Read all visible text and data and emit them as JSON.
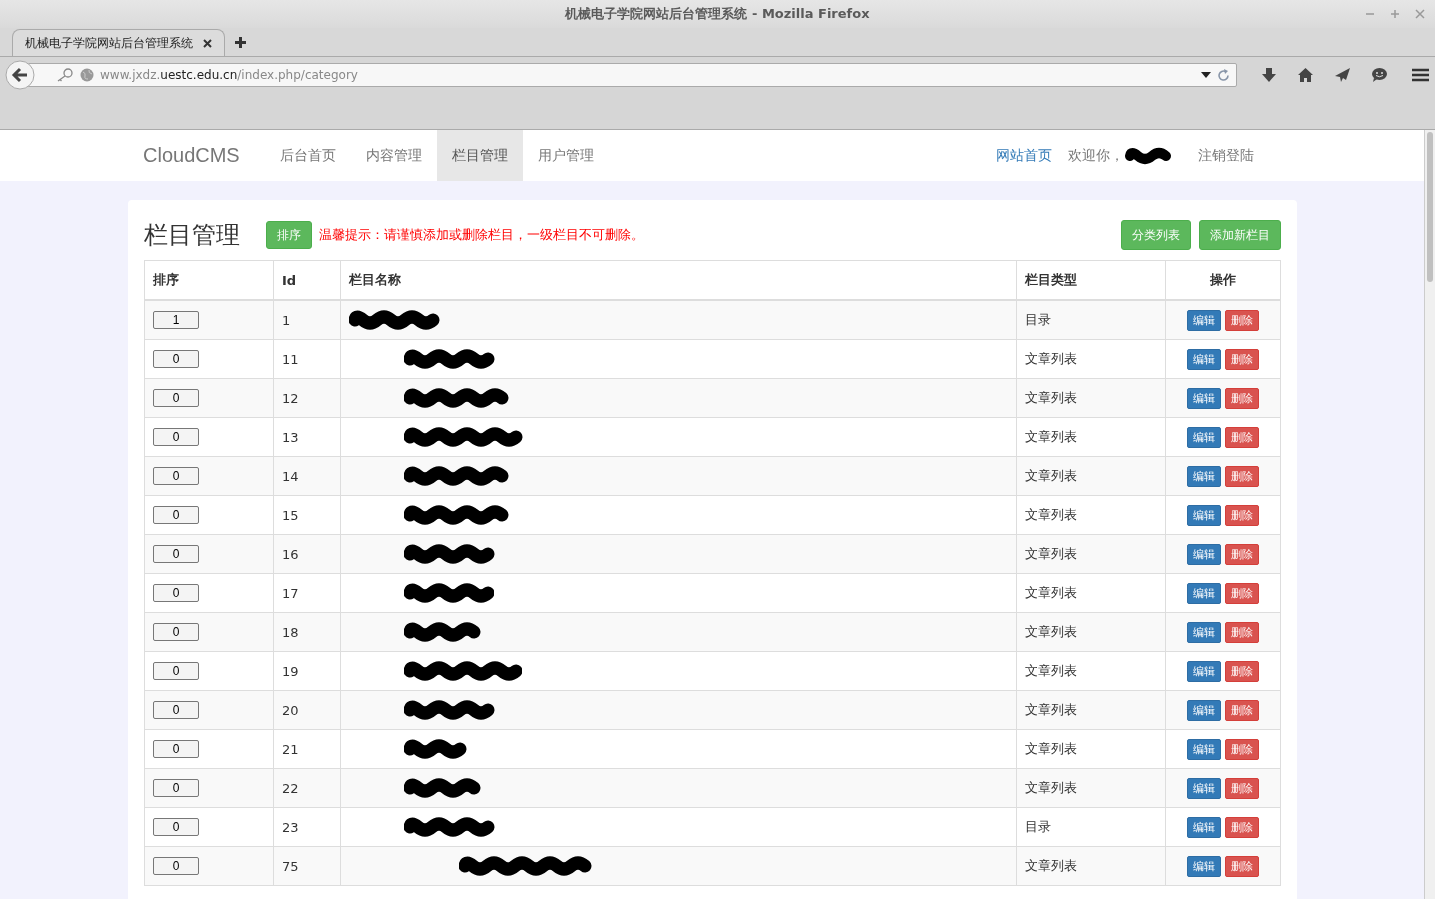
{
  "window": {
    "title": "机械电子学院网站后台管理系统 - Mozilla Firefox"
  },
  "tabs": [
    {
      "label": "机械电子学院网站后台管理系统",
      "selected": true
    }
  ],
  "address_bar": {
    "url_prefix": "www.jxdz.",
    "url_domain": "uestc.edu.cn",
    "url_path": "/index.php/category"
  },
  "navbar": {
    "brand": "CloudCMS",
    "items": [
      {
        "label": "后台首页",
        "selected": false
      },
      {
        "label": "内容管理",
        "selected": false
      },
      {
        "label": "栏目管理",
        "selected": true
      },
      {
        "label": "用户管理",
        "selected": false
      }
    ],
    "home_link": "网站首页",
    "welcome": "欢迎你，",
    "user_redacted": true,
    "logout": "注销登陆"
  },
  "page": {
    "heading": "栏目管理",
    "sort_button": "排序",
    "notice": "温馨提示：请谨慎添加或删除栏目，一级栏目不可删除。",
    "buttons": [
      "分类列表",
      "添加新栏目"
    ]
  },
  "table": {
    "columns": [
      "排序",
      "Id",
      "栏目名称",
      "栏目类型",
      "操作"
    ],
    "rows": [
      {
        "order": "1",
        "id": "1",
        "name_redacted": true,
        "type": "目录",
        "actions": [
          {
            "kind": "edit",
            "label": "编辑"
          },
          {
            "kind": "delete",
            "label": "删除"
          }
        ],
        "children": [
          {
            "order": "0",
            "id": "11",
            "name_redacted": true,
            "type": "文章列表",
            "actions": [
              {
                "kind": "edit",
                "label": "编辑"
              },
              {
                "kind": "delete",
                "label": "删除"
              }
            ]
          },
          {
            "order": "0",
            "id": "12",
            "name_redacted": true,
            "type": "文章列表",
            "actions": [
              {
                "kind": "edit",
                "label": "编辑"
              },
              {
                "kind": "delete",
                "label": "删除"
              }
            ]
          },
          {
            "order": "0",
            "id": "13",
            "name_redacted": true,
            "type": "文章列表",
            "actions": [
              {
                "kind": "edit",
                "label": "编辑"
              },
              {
                "kind": "delete",
                "label": "删除"
              }
            ]
          },
          {
            "order": "0",
            "id": "14",
            "name_redacted": true,
            "type": "文章列表",
            "actions": [
              {
                "kind": "edit",
                "label": "编辑"
              },
              {
                "kind": "delete",
                "label": "删除"
              }
            ]
          },
          {
            "order": "0",
            "id": "15",
            "name_redacted": true,
            "type": "文章列表",
            "actions": [
              {
                "kind": "edit",
                "label": "编辑"
              },
              {
                "kind": "delete",
                "label": "删除"
              }
            ]
          },
          {
            "order": "0",
            "id": "16",
            "name_redacted": true,
            "type": "文章列表",
            "actions": [
              {
                "kind": "edit",
                "label": "编辑"
              },
              {
                "kind": "delete",
                "label": "删除"
              }
            ]
          },
          {
            "order": "0",
            "id": "17",
            "name_redacted": true,
            "type": "文章列表",
            "actions": [
              {
                "kind": "edit",
                "label": "编辑"
              },
              {
                "kind": "delete",
                "label": "删除"
              }
            ]
          },
          {
            "order": "0",
            "id": "18",
            "name_redacted": true,
            "type": "文章列表",
            "actions": [
              {
                "kind": "edit",
                "label": "编辑"
              },
              {
                "kind": "delete",
                "label": "删除"
              }
            ]
          },
          {
            "order": "0",
            "id": "19",
            "name_redacted": true,
            "type": "文章列表",
            "actions": [
              {
                "kind": "edit",
                "label": "编辑"
              },
              {
                "kind": "delete",
                "label": "删除"
              }
            ]
          },
          {
            "order": "0",
            "id": "20",
            "name_redacted": true,
            "type": "文章列表",
            "actions": [
              {
                "kind": "edit",
                "label": "编辑"
              },
              {
                "kind": "delete",
                "label": "删除"
              }
            ]
          },
          {
            "order": "0",
            "id": "21",
            "name_redacted": true,
            "type": "文章列表",
            "actions": [
              {
                "kind": "edit",
                "label": "编辑"
              },
              {
                "kind": "delete",
                "label": "删除"
              }
            ]
          },
          {
            "order": "0",
            "id": "22",
            "name_redacted": true,
            "type": "文章列表",
            "actions": [
              {
                "kind": "edit",
                "label": "编辑"
              },
              {
                "kind": "delete",
                "label": "删除"
              }
            ]
          },
          {
            "order": "0",
            "id": "23",
            "name_redacted": true,
            "type": "目录",
            "actions": [
              {
                "kind": "edit",
                "label": "编辑"
              },
              {
                "kind": "delete",
                "label": "删除"
              }
            ],
            "children": [
              {
                "order": "0",
                "id": "75",
                "name_redacted": true,
                "type": "文章列表",
                "actions": [
                  {
                    "kind": "edit",
                    "label": "编辑"
                  },
                  {
                    "kind": "delete",
                    "label": "删除"
                  }
                ]
              }
            ]
          }
        ]
      }
    ]
  }
}
